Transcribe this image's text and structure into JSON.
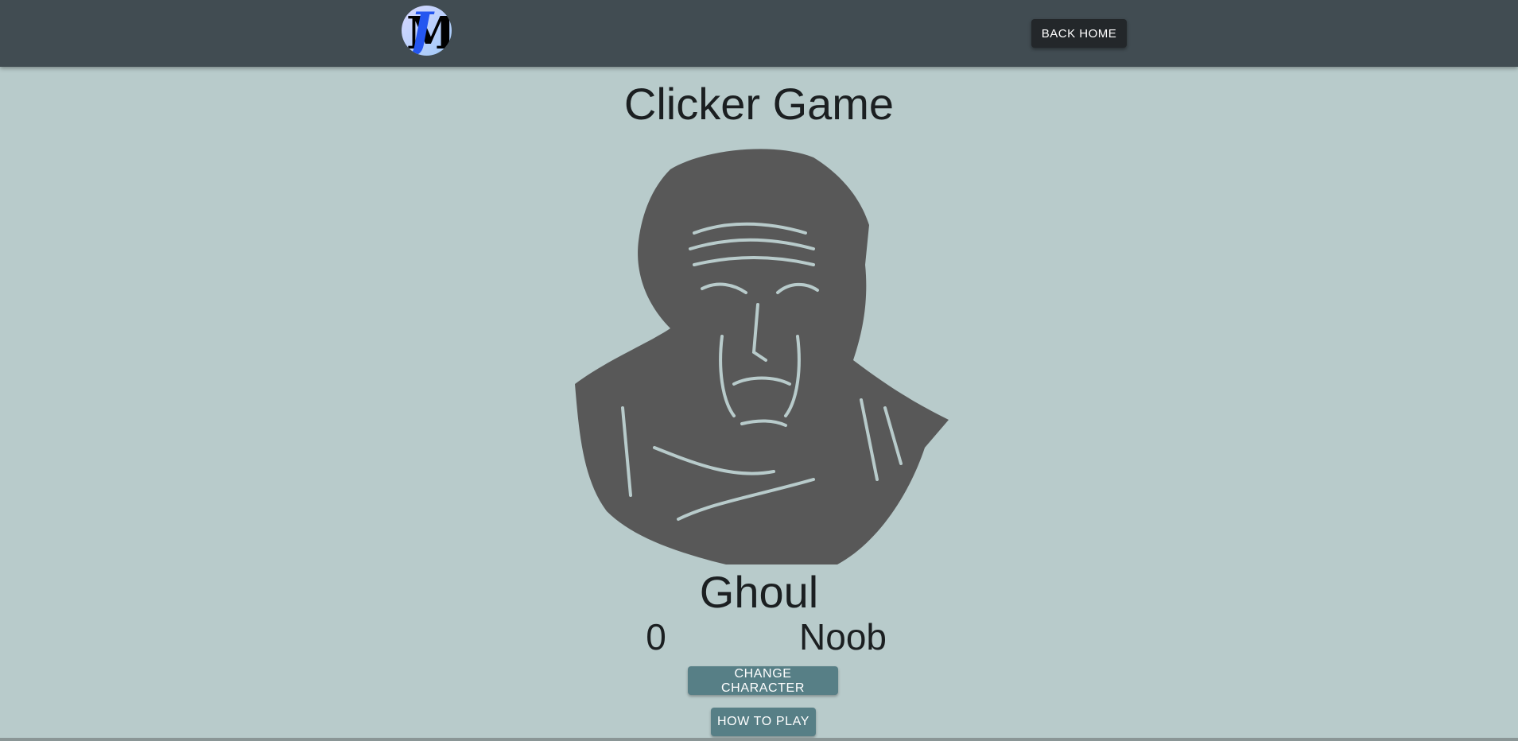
{
  "header": {
    "logo_text": "JM",
    "back_home_label": "BACK HOME"
  },
  "main": {
    "title": "Clicker Game",
    "character_name": "Ghoul",
    "score": "0",
    "rank": "Noob",
    "change_character_label": "CHANGE CHARACTER",
    "how_to_play_label": "HOW TO PLAY"
  },
  "colors": {
    "header": "#414c52",
    "background": "#b8cbcb",
    "button": "#577f86",
    "illustration": "#585858"
  }
}
